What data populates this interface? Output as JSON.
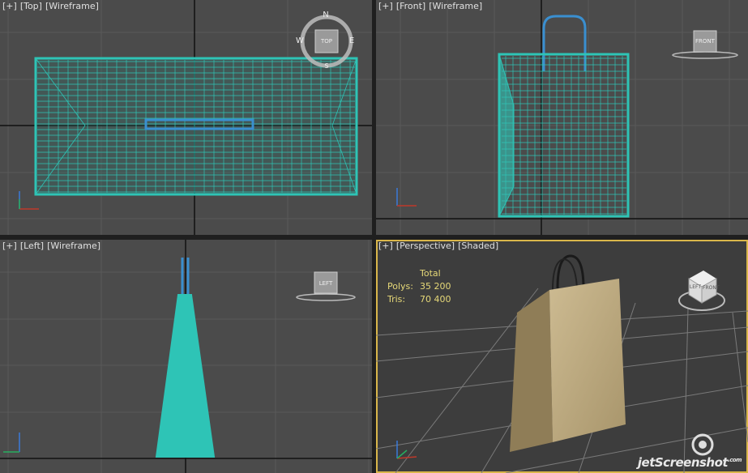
{
  "viewports": {
    "top": {
      "plus": "[+]",
      "view": "[Top]",
      "mode": "[Wireframe]",
      "cube": "TOP",
      "compass": {
        "n": "N",
        "w": "W",
        "e": "E",
        "s": "S"
      }
    },
    "front": {
      "plus": "[+]",
      "view": "[Front]",
      "mode": "[Wireframe]",
      "cube": "FRONT"
    },
    "left": {
      "plus": "[+]",
      "view": "[Left]",
      "mode": "[Wireframe]",
      "cube": "LEFT"
    },
    "perspective": {
      "plus": "[+]",
      "view": "[Perspective]",
      "mode": "[Shaded]",
      "cube_left": "LEFT",
      "cube_front": "FRONT"
    }
  },
  "stats": {
    "header": "Total",
    "polys_label": "Polys:",
    "polys_value": "35 200",
    "tris_label": "Tris:",
    "tris_value": "70 400"
  },
  "axis_labels": {
    "z": "z"
  },
  "watermark": "jetScreenshot",
  "watermark_suffix": ".com",
  "colors": {
    "viewport_bg": "#4b4b4b",
    "wire": "#2ec4b6",
    "handle": "#3a8fd0",
    "active_border": "#d9b64a",
    "bag": "#b9a57e",
    "stats_text": "#e6d878"
  }
}
